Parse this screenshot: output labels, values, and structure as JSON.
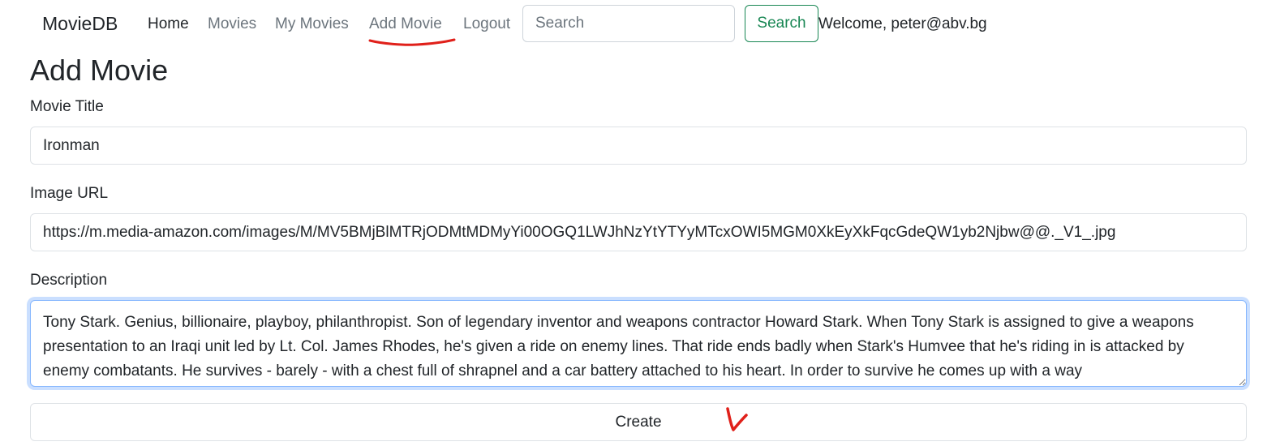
{
  "navbar": {
    "brand": "MovieDB",
    "links": [
      {
        "label": "Home",
        "active": true
      },
      {
        "label": "Movies",
        "active": false
      },
      {
        "label": "My Movies",
        "active": false
      },
      {
        "label": "Add Movie",
        "active": false
      },
      {
        "label": "Logout",
        "active": false
      }
    ],
    "search": {
      "placeholder": "Search",
      "value": "",
      "button_label": "Search"
    },
    "welcome_text": "Welcome, peter@abv.bg"
  },
  "page": {
    "title": "Add Movie"
  },
  "form": {
    "title_label": "Movie Title",
    "title_value": "Ironman",
    "image_label": "Image URL",
    "image_value": "https://m.media-amazon.com/images/M/MV5BMjBlMTRjODMtMDMyYi00OGQ1LWJhNzYtYTYyMTcxOWI5MGM0XkEyXkFqcGdeQW1yb2Njbw@@._V1_.jpg",
    "description_label": "Description",
    "description_value": "Tony Stark. Genius, billionaire, playboy, philanthropist. Son of legendary inventor and weapons contractor Howard Stark. When Tony Stark is assigned to give a weapons presentation to an Iraqi unit led by Lt. Col. James Rhodes, he's given a ride on enemy lines. That ride ends badly when Stark's Humvee that he's riding in is attacked by enemy combatants. He survives - barely - with a chest full of shrapnel and a car battery attached to his heart. In order to survive he comes up with a way",
    "submit_label": "Create"
  },
  "colors": {
    "text": "#212529",
    "muted": "#6c757d",
    "success": "#198754",
    "border": "#dee2e6",
    "focus_border": "#86b7fe",
    "annotation_red": "#e0201a"
  },
  "annotations": {
    "underline_target": "Add Movie",
    "checkmark_near": "Create"
  }
}
